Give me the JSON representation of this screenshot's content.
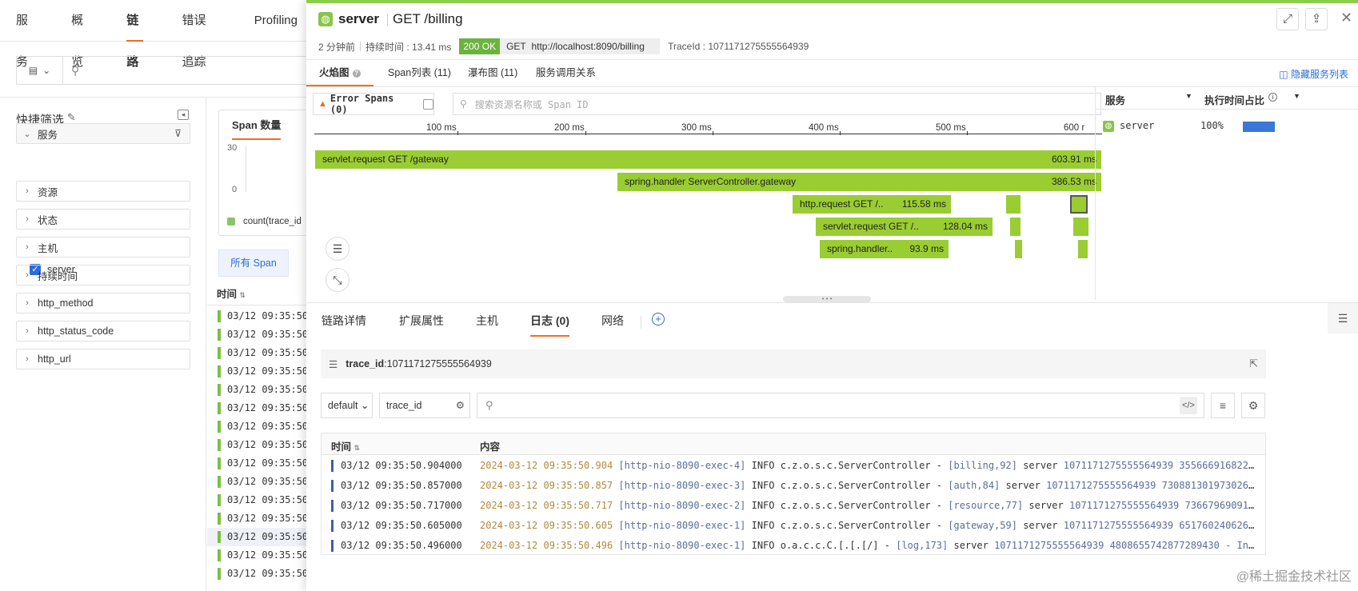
{
  "nav": {
    "items": [
      "服务",
      "概览",
      "链路",
      "错误追踪",
      "Profiling"
    ],
    "active": "链路"
  },
  "quick_filter": {
    "title": "快捷筛选",
    "facets": [
      "服务",
      "资源",
      "状态",
      "主机",
      "持续时间",
      "http_method",
      "http_status_code",
      "http_url"
    ],
    "service_value": "server"
  },
  "chart_card": {
    "tab": "Span 数量",
    "y_top": "30",
    "y_bottom": "0",
    "legend": "count(trace_id"
  },
  "span_table": {
    "tab": "所有 Span",
    "header": "时间",
    "rows": [
      "03/12 09:35:50",
      "03/12 09:35:50",
      "03/12 09:35:50",
      "03/12 09:35:50",
      "03/12 09:35:50",
      "03/12 09:35:50",
      "03/12 09:35:50",
      "03/12 09:35:50",
      "03/12 09:35:50",
      "03/12 09:35:50",
      "03/12 09:35:50",
      "03/12 09:35:50",
      "03/12 09:35:50",
      "03/12 09:35:50",
      "03/12 09:35:50"
    ]
  },
  "drawer": {
    "service": "server",
    "operation": "GET /billing",
    "time_ago": "2 分钟前",
    "duration": "持续时间 : 13.41 ms",
    "status": "200 OK",
    "method": "GET",
    "url": "http://localhost:8090/billing",
    "trace_id": "TraceId : 1071171275555564939",
    "tabs": [
      "火焰图",
      "Span列表 (11)",
      "瀑布图 (11)",
      "服务调用关系"
    ],
    "hide_service_list": "隐藏服务列表",
    "error_spans": "Error Spans (0)",
    "search_placeholder": "搜索资源名称或 Span ID",
    "scale_ticks": [
      "100 ms",
      "200 ms",
      "300 ms",
      "400 ms",
      "500 ms",
      "600 r"
    ],
    "flame": [
      {
        "label": "servlet.request GET /gateway",
        "duration": "603.91 ms"
      },
      {
        "label": "spring.handler ServerController.gateway",
        "duration": "386.53 ms"
      },
      {
        "label": "http.request GET /..",
        "duration": "115.58 ms"
      },
      {
        "label": "servlet.request GET /..",
        "duration": "128.04 ms"
      },
      {
        "label": "spring.handler..",
        "duration": "93.9 ms"
      }
    ],
    "service_panel": {
      "col1": "服务",
      "col2": "执行时间占比",
      "rows": [
        {
          "name": "server",
          "pct": "100%",
          "fraction": 1.0
        }
      ]
    },
    "bottom_tabs": [
      "链路详情",
      "扩展属性",
      "主机",
      "日志 (0)",
      "网络"
    ],
    "log": {
      "query_key": "trace_id",
      "query_value": ":1071171275555564939",
      "index_select": "default",
      "field_select": "trace_id",
      "col_time": "时间",
      "col_content": "内容",
      "rows": [
        {
          "time": "03/12 09:35:50.904000",
          "ts": "2024-03-12 09:35:50.904",
          "thread": "[http-nio-8090-exec-4]",
          "level": "INFO c.z.o.s.c.ServerController -",
          "loc": "[billing,92]",
          "svc": "server",
          "ids": "1071171275555564939 3556669168222585635 - t…"
        },
        {
          "time": "03/12 09:35:50.857000",
          "ts": "2024-03-12 09:35:50.857",
          "thread": "[http-nio-8090-exec-3]",
          "level": "INFO c.z.o.s.c.ServerController -",
          "loc": "[auth,84]",
          "svc": "server",
          "ids": "1071171275555564939 7308813019730268073 - this…"
        },
        {
          "time": "03/12 09:35:50.717000",
          "ts": "2024-03-12 09:35:50.717",
          "thread": "[http-nio-8090-exec-2]",
          "level": "INFO c.z.o.s.c.ServerController -",
          "loc": "[resource,77]",
          "svc": "server",
          "ids": "1071171275555564939 7366796909189520503 - …"
        },
        {
          "time": "03/12 09:35:50.605000",
          "ts": "2024-03-12 09:35:50.605",
          "thread": "[http-nio-8090-exec-1]",
          "level": "INFO c.z.o.s.c.ServerController -",
          "loc": "[gateway,59]",
          "svc": "server",
          "ids": "1071171275555564939 6517602406269772680 - t…"
        },
        {
          "time": "03/12 09:35:50.496000",
          "ts": "2024-03-12 09:35:50.496",
          "thread": "[http-nio-8090-exec-1]",
          "level": "INFO o.a.c.c.C.[.[.[/] -",
          "loc": "[log,173]",
          "svc": "server",
          "ids": "1071171275555564939 4808655742877289430 - Initializing …"
        }
      ]
    }
  },
  "watermark": "@稀土掘金技术社区"
}
